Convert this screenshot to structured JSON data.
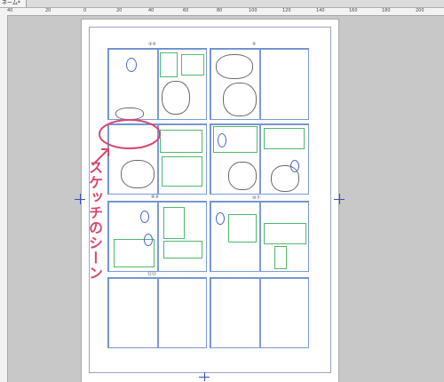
{
  "app": {
    "tab_title": "ネーム*"
  },
  "ruler": {
    "labels": [
      "40",
      "20",
      "0",
      "20",
      "40",
      "60",
      "80",
      "100",
      "120",
      "140",
      "160",
      "180",
      "200"
    ]
  },
  "annotation": {
    "text": "スケッチのシーン"
  },
  "pages": [
    {
      "label": "③④",
      "pos": "top-left"
    },
    {
      "label": "⑤",
      "pos": "top-right"
    },
    {
      "label": "",
      "pos": "middle-left"
    },
    {
      "label": "",
      "pos": "middle-right"
    },
    {
      "label": "⑧⑨",
      "pos": "lower-left"
    },
    {
      "label": "⑩⑪",
      "pos": "lower-right"
    },
    {
      "label": "⑫⑬",
      "pos": "bottom-left"
    },
    {
      "label": "",
      "pos": "bottom-right"
    }
  ],
  "colors": {
    "canvas_bg": "#c8c8c8",
    "panel_line": "#7c9bd7",
    "frame_green": "#4fb96b",
    "annotation": "#d8466f",
    "registration_mark": "#3e4cc9"
  }
}
